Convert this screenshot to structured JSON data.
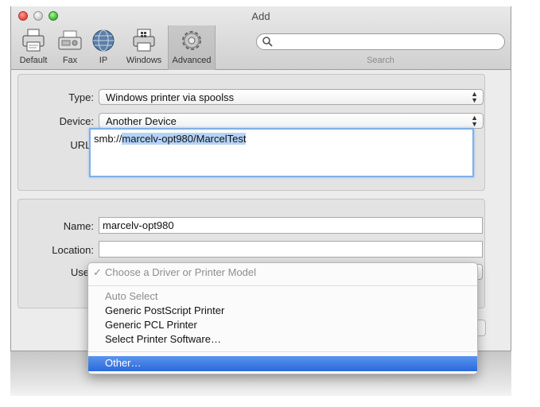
{
  "window": {
    "title": "Add"
  },
  "toolbar": {
    "items": [
      {
        "label": "Default",
        "icon": "printer-icon"
      },
      {
        "label": "Fax",
        "icon": "fax-icon"
      },
      {
        "label": "IP",
        "icon": "globe-icon"
      },
      {
        "label": "Windows",
        "icon": "windows-printer-icon"
      },
      {
        "label": "Advanced",
        "icon": "gear-icon",
        "selected": true
      }
    ],
    "search": {
      "label": "Search",
      "value": ""
    }
  },
  "connection": {
    "type_label": "Type:",
    "type_value": "Windows printer via spoolss",
    "device_label": "Device:",
    "device_value": "Another Device",
    "url_label": "URL:",
    "url_prefix": "smb://",
    "url_selected": "marcelv-opt980/MarcelTest"
  },
  "details": {
    "name_label": "Name:",
    "name_value": "marcelv-opt980",
    "location_label": "Location:",
    "location_value": "",
    "use_label_partial": "Use"
  },
  "driver_menu": {
    "checked_item": "Choose a Driver or Printer Model",
    "check_glyph": "✓",
    "items": [
      {
        "label": "Auto Select",
        "enabled": false
      },
      {
        "label": "Generic PostScript Printer",
        "enabled": true
      },
      {
        "label": "Generic PCL Printer",
        "enabled": true
      },
      {
        "label": "Select Printer Software…",
        "enabled": true
      }
    ],
    "highlighted_item": "Other…"
  },
  "colors": {
    "highlight": "#2b68dc",
    "focus_ring": "#7eb0e6",
    "selection": "#b5d3f7"
  }
}
